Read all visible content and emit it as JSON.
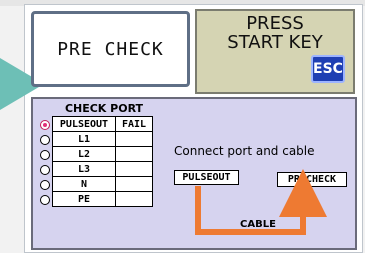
{
  "banner": {
    "pre_check": "PRE CHECK",
    "press_start_line1": "PRESS",
    "press_start_line2": "START KEY",
    "esc_label": "ESC"
  },
  "check_port": {
    "title": "CHECK PORT",
    "rows": [
      {
        "port": "PULSEOUT",
        "result": "FAIL",
        "selected": true
      },
      {
        "port": "L1",
        "result": "",
        "selected": false
      },
      {
        "port": "L2",
        "result": "",
        "selected": false
      },
      {
        "port": "L3",
        "result": "",
        "selected": false
      },
      {
        "port": "N",
        "result": "",
        "selected": false
      },
      {
        "port": "PE",
        "result": "",
        "selected": false
      }
    ]
  },
  "instructions": {
    "connect_text": "Connect port and cable",
    "pulseout_label": "PULSEOUT",
    "precheck_label": "PRECHECK",
    "cable_label": "CABLE"
  },
  "colors": {
    "cable": "#ee7a32",
    "arrow": "#6dbfb6",
    "esc_key": "#1f3fb3",
    "panel_bg": "#d6d3ef",
    "press_bg": "#d5d4b3"
  }
}
